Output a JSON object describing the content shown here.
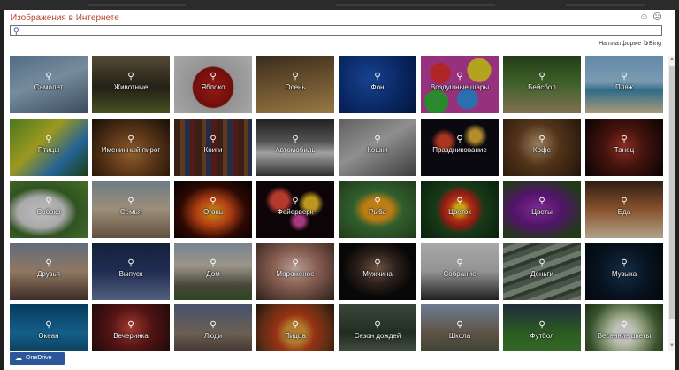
{
  "dialog": {
    "title": "Изображения в Интернете",
    "search": {
      "value": "",
      "placeholder": ""
    },
    "powered_by": "На платформе",
    "bing": "Bing",
    "onedrive_label": "OneDrive"
  },
  "tiles": [
    {
      "label": "Самолет",
      "bg": "linear-gradient(160deg,#6a8cab 0%,#98b3c9 45%,#4a6378 100%)"
    },
    {
      "label": "Животные",
      "bg": "linear-gradient(180deg,#6b6045 0%,#2f2a1d 55%,#5b6a2f 100%)"
    },
    {
      "label": "Яблоко",
      "bg": "radial-gradient(circle at 50% 55%,#c3211c 0%,#8e120f 40%,#bcbcbc 42%,#d8d8d8 100%)"
    },
    {
      "label": "Осень",
      "bg": "linear-gradient(170deg,#4a3a26 0%,#8a6a3d 50%,#c39b57 100%)"
    },
    {
      "label": "Фон",
      "bg": "radial-gradient(circle at 40% 40%,#1f55b8 0%,#0c2f7a 60%,#061b4d 100%)"
    },
    {
      "label": "Воздушные шары",
      "bg": "radial-gradient(circle at 25% 30%,#e23030 0 14%,transparent 15%),radial-gradient(circle at 75% 25%,#e7d12a 0 16%,transparent 17%),radial-gradient(circle at 60% 75%,#3a8ee0 0 16%,transparent 17%),radial-gradient(circle at 20% 80%,#38b03a 0 15%,transparent 16%),#c03fa0"
    },
    {
      "label": "Бейсбол",
      "bg": "linear-gradient(180deg,#2e4e1f 0%,#4e7a33 45%,#a4916a 100%)"
    },
    {
      "label": "Пляж",
      "bg": "linear-gradient(180deg,#7fb0d8 0%,#9fc7e3 45%,#3f8bb0 60%,#d8c79c 100%)"
    },
    {
      "label": "Птицы",
      "bg": "linear-gradient(135deg,#5f9a2a 0%,#c7c428 40%,#2f7fbf 70%,#245218 100%)"
    },
    {
      "label": "Именинный пирог",
      "bg": "radial-gradient(ellipse at 50% 60%,#b8773a 0%,#6b3f1c 50%,#1c120a 100%)"
    },
    {
      "label": "Книги",
      "bg": "repeating-linear-gradient(90deg,#4a2a1a 0 7px,#7a4a2a 7px 12px,#2c3a5a 12px 18px,#6b2020 18px 24px)"
    },
    {
      "label": "Автомобиль",
      "bg": "linear-gradient(180deg,#2a2a2a 0%,#6a6a6a 40%,#cfcfcf 60%,#3a3a3a 100%)"
    },
    {
      "label": "Кошки",
      "bg": "linear-gradient(150deg,#7a7a7a 0%,#b7b7b7 45%,#4f4f4f 100%)"
    },
    {
      "label": "Праздникование",
      "bg": "radial-gradient(circle at 30% 40%,#d6452a 0 10%,transparent 20%),radial-gradient(circle at 70% 30%,#e7b43a 0 8%,transparent 18%),#0c0c14"
    },
    {
      "label": "Кофе",
      "bg": "radial-gradient(circle at 45% 45%,#c7a27a 0%,#6a4321 40%,#2a1a0e 100%)"
    },
    {
      "label": "Танец",
      "bg": "radial-gradient(circle at 50% 50%,#b83a2a 0%,#5a1a12 40%,#0a0505 100%)"
    },
    {
      "label": "Собака",
      "bg": "radial-gradient(ellipse at 40% 55%,#f2f2f2 0%,#d9d9d9 35%,#3d6b2a 55%,#5b8f36 100%)"
    },
    {
      "label": "Семья",
      "bg": "linear-gradient(180deg,#8aa0ad 0%,#c8b69a 50%,#7c6650 100%)"
    },
    {
      "label": "Огонь",
      "bg": "radial-gradient(ellipse at 50% 55%,#ffb21f 0%,#e2531a 30%,#3a0c04 60%,#050202 100%)"
    },
    {
      "label": "Фейерверк",
      "bg": "radial-gradient(circle at 30% 35%,#e84a3a 0 12%,transparent 22%),radial-gradient(circle at 70% 40%,#f2c02a 0 10%,transparent 20%),radial-gradient(circle at 55% 70%,#d84aa0 0 8%,transparent 18%),#10060a"
    },
    {
      "label": "Рыба",
      "bg": "radial-gradient(ellipse at 50% 50%,#f2a01a 0 25%,#3f7a3a 45%,#2a4a20 100%)"
    },
    {
      "label": "Цветок",
      "bg": "radial-gradient(circle at 50% 50%,#ffd21a 0 10%,#e0451a 22%,#b8241a 35%,#1f4a1f 50%,#0e2a10 100%)"
    },
    {
      "label": "Цветы",
      "bg": "radial-gradient(ellipse at 45% 50%,#a03ab8 0%,#6a1a8a 40%,#2c4a1f 80%)"
    },
    {
      "label": "Еда",
      "bg": "linear-gradient(180deg,#3a2418 0%,#b06a3a 50%,#e0d0b0 100%)"
    },
    {
      "label": "Друзья",
      "bg": "linear-gradient(180deg,#7a8aa0 0%,#b89a80 50%,#4f3a30 100%)"
    },
    {
      "label": "Выпуск",
      "bg": "linear-gradient(180deg,#1a2a4a 0%,#2a3a6a 50%,#6a7aa0 100%)"
    },
    {
      "label": "Дом",
      "bg": "linear-gradient(180deg,#9aa8b8 0%,#c8c0b0 40%,#5a5a4a 75%,#3a5a2a 100%)"
    },
    {
      "label": "Мороженое",
      "bg": "radial-gradient(ellipse at 50% 45%,#e8c8c0 0%,#b07a6a 40%,#3a2a22 100%)"
    },
    {
      "label": "Мужчина",
      "bg": "radial-gradient(ellipse at 50% 45%,#8a6a58 0%,#3a2a22 35%,#0a0a0a 65%)"
    },
    {
      "label": "Собрание",
      "bg": "linear-gradient(180deg,#d8d8d8 0%,#bcbcbc 50%,#2a2a2a 100%)"
    },
    {
      "label": "Деньги",
      "bg": "repeating-linear-gradient(160deg,#5a6a5a 0 6px,#8a9a88 6px 12px,#3a4a3a 12px 16px)"
    },
    {
      "label": "Музыка",
      "bg": "radial-gradient(circle at 50% 50%,#1a3a5a 0%,#0a1a2a 50%,#050a10 100%)"
    },
    {
      "label": "Океан",
      "bg": "linear-gradient(180deg,#0a4a7a 0%,#1a7ab0 50%,#0a3a5a 100%)"
    },
    {
      "label": "Вечеринка",
      "bg": "radial-gradient(circle at 50% 40%,#d04a3a 0%,#6a1a1a 40%,#1a0a0a 100%)"
    },
    {
      "label": "Люди",
      "bg": "linear-gradient(180deg,#5a6a8a 0%,#8a7a6a 50%,#3a2a2a 100%)"
    },
    {
      "label": "Пицца",
      "bg": "radial-gradient(circle at 50% 50%,#e0a03a 0 20%,#c0401a 40%,#7a3a1a 70%,#2a1a10 100%)"
    },
    {
      "label": "Сезон дождей",
      "bg": "linear-gradient(180deg,#4a5a4a 0%,#2a3a2a 50%,#6a7a6a 100%)"
    },
    {
      "label": "Школа",
      "bg": "linear-gradient(180deg,#8aa0b8 0%,#7a6a5a 50%,#3a4a3a 100%)"
    },
    {
      "label": "Футбол",
      "bg": "linear-gradient(180deg,#2a3a4a 0%,#3a7a2a 55%,#4a8a3a 100%)"
    },
    {
      "label": "Весенние цветы",
      "bg": "radial-gradient(circle at 50% 50%,#f5f5f0 0 20%,#c8d8b0 35%,#4a6a3a 70%,#2a3a1a 100%)"
    }
  ]
}
